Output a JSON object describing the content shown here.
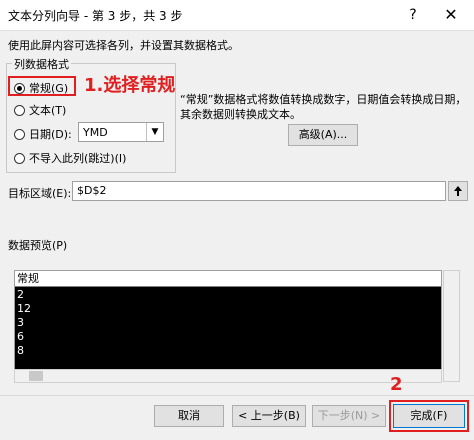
{
  "window": {
    "title": "文本分列向导 - 第 3 步，共 3 步",
    "help": "?",
    "close": "✕"
  },
  "instruction": "使用此屏内容可选择各列，并设置其数据格式。",
  "column_format": {
    "legend": "列数据格式",
    "options": [
      {
        "label": "常规(G)",
        "checked": true
      },
      {
        "label": "文本(T)",
        "checked": false
      },
      {
        "label": "日期(D):",
        "checked": false
      },
      {
        "label": "不导入此列(跳过)(I)",
        "checked": false
      }
    ],
    "date_format": "YMD"
  },
  "annotations": {
    "step1": "1.选择常规",
    "step2": "2"
  },
  "description": "“常规”数据格式将数值转换成数字，日期值会转换成日期，其余数据则转换成文本。",
  "advanced_button": "高级(A)...",
  "destination": {
    "label": "目标区域(E):",
    "value": "$D$2"
  },
  "preview": {
    "label": "数据预览(P)",
    "header": "常规",
    "rows": [
      "2",
      "12",
      "3",
      "6",
      "8"
    ]
  },
  "buttons": {
    "cancel": "取消",
    "back": "< 上一步(B)",
    "next": "下一步(N) >",
    "finish": "完成(F)"
  }
}
